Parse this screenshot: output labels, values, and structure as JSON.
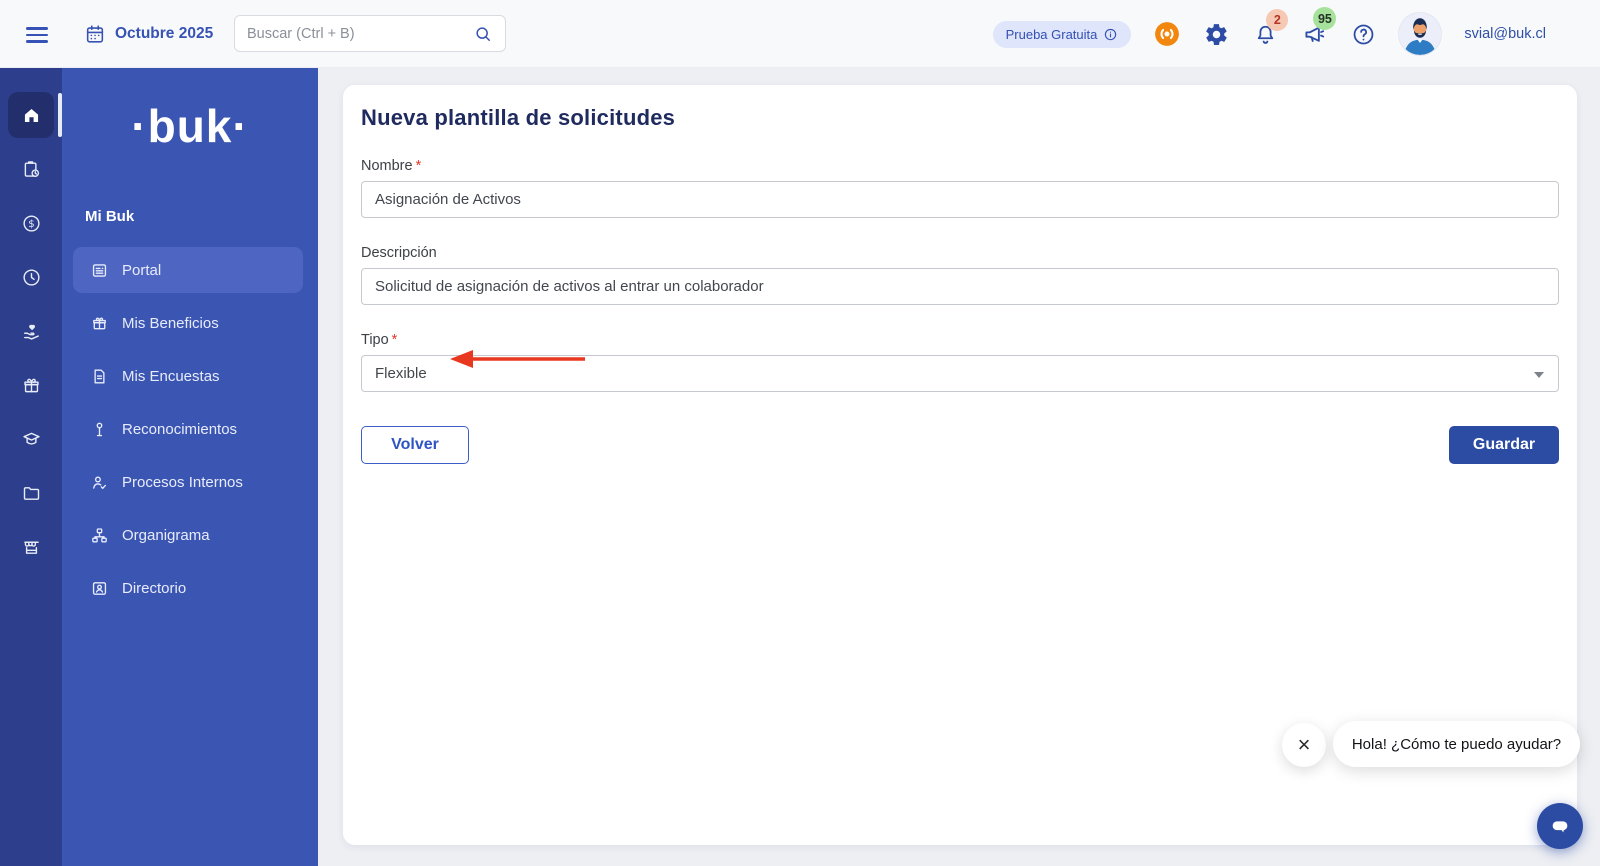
{
  "topbar": {
    "date": "Octubre 2025",
    "search_placeholder": "Buscar (Ctrl + B)",
    "trial_label": "Prueba Gratuita",
    "notifications_badge": "2",
    "announcements_badge": "95",
    "user_email": "svial@buk.cl"
  },
  "sidebar": {
    "logo_text": "·buk·",
    "section_label": "Mi Buk",
    "items": [
      {
        "label": "Portal",
        "icon": "portal-icon",
        "active": true
      },
      {
        "label": "Mis Beneficios",
        "icon": "benefits-gift-icon",
        "active": false
      },
      {
        "label": "Mis Encuestas",
        "icon": "surveys-document-icon",
        "active": false
      },
      {
        "label": "Reconocimientos",
        "icon": "recognition-medal-icon",
        "active": false
      },
      {
        "label": "Procesos Internos",
        "icon": "internal-processes-person-check-icon",
        "active": false
      },
      {
        "label": "Organigrama",
        "icon": "org-chart-icon",
        "active": false
      },
      {
        "label": "Directorio",
        "icon": "directory-contact-card-icon",
        "active": false
      }
    ],
    "rail_icons": [
      "home-icon",
      "clipboard-clock-icon",
      "payroll-money-icon",
      "time-clock-icon",
      "wellness-hand-heart-icon",
      "benefits-gift-icon",
      "training-graduation-icon",
      "documents-folder-icon",
      "company-storefront-icon"
    ]
  },
  "main": {
    "title": "Nueva plantilla de solicitudes",
    "required_marker": "*",
    "fields": {
      "name": {
        "label": "Nombre",
        "value": "Asignación de Activos"
      },
      "description": {
        "label": "Descripción",
        "value": "Solicitud de asignación de activos al entrar un colaborador"
      },
      "type": {
        "label": "Tipo",
        "value": "Flexible"
      }
    },
    "buttons": {
      "back": "Volver",
      "save": "Guardar"
    }
  },
  "chat": {
    "tooltip_text": "Hola! ¿Cómo te puedo ayudar?",
    "close_label": "×"
  },
  "colors": {
    "accent_blue": "#2d4ca6",
    "sidebar_rail": "#2c3e8c",
    "sidebar_panel": "#3b55b3",
    "active_item_blue": "#4e66c2",
    "save_button_blue": "#2c4ba3",
    "annotation_red": "#e8381f",
    "trial_pill_bg": "#dfe5fb",
    "notification_badge_bg": "#f6c9b4",
    "notification_badge_text": "#b53527",
    "announcement_badge_bg": "#a6e29b",
    "orange_app_icon": "#f2870f"
  }
}
